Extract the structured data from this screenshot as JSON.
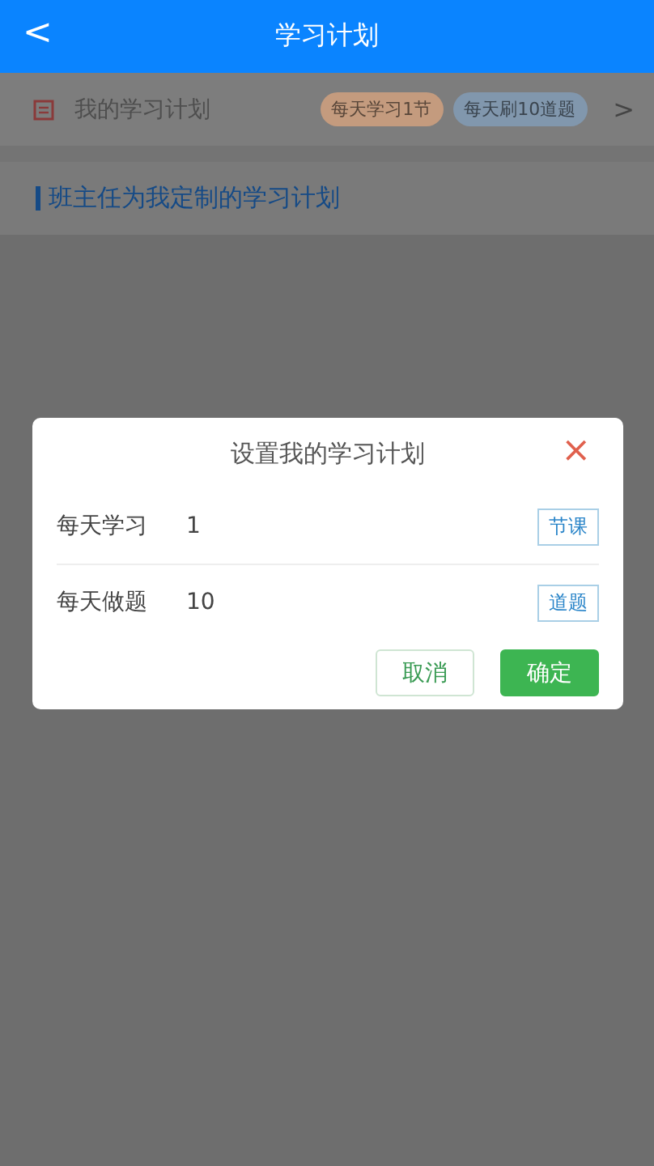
{
  "header": {
    "back": "<",
    "title": "学习计划"
  },
  "plan_bar": {
    "label": "我的学习计划",
    "tags": [
      {
        "text": "每天学习1节",
        "color": "#c49b7e"
      },
      {
        "text": "每天刷10道题",
        "color": "#8197ad"
      }
    ],
    "more": ">"
  },
  "section_title": "班主任为我定制的学习计划",
  "dialog": {
    "title": "设置我的学习计划",
    "close": "×",
    "rows": [
      {
        "label": "每天学习",
        "value": "1",
        "unit": "节课"
      },
      {
        "label": "每天做题",
        "value": "10",
        "unit": "道题"
      }
    ],
    "buttons": [
      {
        "label": "取消",
        "kind": "secondary"
      },
      {
        "label": "确定",
        "kind": "primary"
      }
    ]
  }
}
